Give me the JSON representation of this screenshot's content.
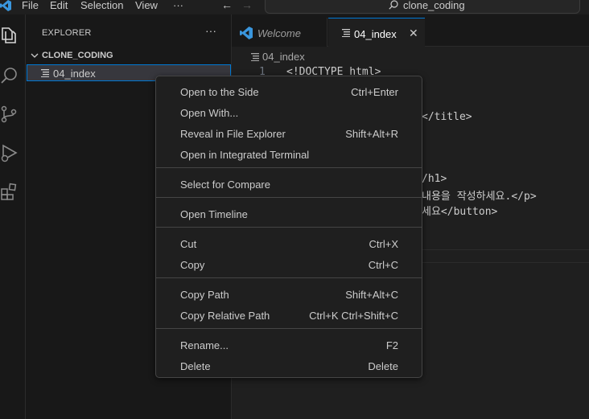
{
  "titlebar": {
    "menu": [
      "File",
      "Edit",
      "Selection",
      "View"
    ],
    "more": "···",
    "back": "←",
    "forward": "→",
    "search_text": "clone_coding"
  },
  "sidebar": {
    "title": "EXPLORER",
    "more": "···",
    "folder": "CLONE_CODING",
    "file": "04_index"
  },
  "tabs": [
    {
      "label": "Welcome",
      "close": ""
    },
    {
      "label": "04_index",
      "close": "✕"
    }
  ],
  "editor": {
    "breadcrumb": "04_index",
    "line_numbers": [
      "1"
    ],
    "lines": [
      "<!DOCTYPE html>",
      "</title>",
      "/h1>",
      "내용을 작성하세요.</p>",
      "세요</button>"
    ]
  },
  "context_menu": {
    "groups": [
      [
        {
          "label": "Open to the Side",
          "key": "Ctrl+Enter"
        },
        {
          "label": "Open With...",
          "key": ""
        },
        {
          "label": "Reveal in File Explorer",
          "key": "Shift+Alt+R"
        },
        {
          "label": "Open in Integrated Terminal",
          "key": ""
        }
      ],
      [
        {
          "label": "Select for Compare",
          "key": ""
        }
      ],
      [
        {
          "label": "Open Timeline",
          "key": ""
        }
      ],
      [
        {
          "label": "Cut",
          "key": "Ctrl+X"
        },
        {
          "label": "Copy",
          "key": "Ctrl+C"
        }
      ],
      [
        {
          "label": "Copy Path",
          "key": "Shift+Alt+C"
        },
        {
          "label": "Copy Relative Path",
          "key": "Ctrl+K Ctrl+Shift+C"
        }
      ],
      [
        {
          "label": "Rename...",
          "key": "F2"
        },
        {
          "label": "Delete",
          "key": "Delete"
        }
      ]
    ]
  },
  "colors": {
    "accent": "#0078d4",
    "background": "#1f1f1f",
    "sidebar": "#181818",
    "vscode_logo": "#3a96dd"
  },
  "icons": [
    "vscode-logo-icon",
    "search-icon",
    "explorer-icon",
    "search-view-icon",
    "source-control-icon",
    "run-debug-icon",
    "extensions-icon",
    "chevron-down-icon",
    "file-lines-icon"
  ]
}
